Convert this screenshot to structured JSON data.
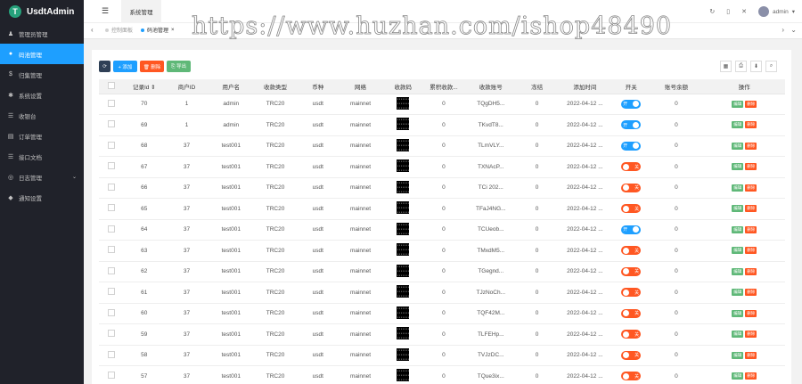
{
  "brand": {
    "logo": "T",
    "name": "UsdtAdmin"
  },
  "sidebar": {
    "items": [
      {
        "icon": "user-icon",
        "glyph": "♟",
        "label": "管理员管理",
        "active": false,
        "chevron": false
      },
      {
        "icon": "coin-icon",
        "glyph": "●",
        "label": "码池管理",
        "active": true,
        "chevron": false
      },
      {
        "icon": "dollar-icon",
        "glyph": "$",
        "label": "归集管理",
        "active": false,
        "chevron": false
      },
      {
        "icon": "gear-icon",
        "glyph": "✱",
        "label": "系统设置",
        "active": false,
        "chevron": false
      },
      {
        "icon": "list-icon",
        "glyph": "☰",
        "label": "收银台",
        "active": false,
        "chevron": false
      },
      {
        "icon": "order-icon",
        "glyph": "▤",
        "label": "订单管理",
        "active": false,
        "chevron": false
      },
      {
        "icon": "doc-icon",
        "glyph": "☰",
        "label": "接口文档",
        "active": false,
        "chevron": false
      },
      {
        "icon": "log-icon",
        "glyph": "◎",
        "label": "日志管理",
        "active": false,
        "chevron": true
      },
      {
        "icon": "bell-icon",
        "glyph": "◆",
        "label": "通知设置",
        "active": false,
        "chevron": false
      }
    ]
  },
  "header": {
    "menu_glyph": "☰",
    "top_tab": "系统管理",
    "user": "admin",
    "icons": {
      "refresh": "↻",
      "lock": "▯",
      "fullscreen": "✕",
      "dropdown": "▾"
    }
  },
  "tabbar": {
    "prev": "‹",
    "next": "›",
    "more": "⌄",
    "tabs": [
      {
        "label": "控制面板",
        "current": false
      },
      {
        "label": "码池管理",
        "current": true,
        "close": "×"
      }
    ]
  },
  "watermark": "https://www.huzhan.com/ishop48490",
  "toolbar": {
    "refresh_glyph": "⟳",
    "add": "+ 添加",
    "delete": "🗑 删除",
    "export": "⎘ 导出",
    "right_icons": [
      "▦",
      "⎙",
      "⬇",
      "⌕"
    ]
  },
  "table": {
    "headers": [
      "",
      "记录Id ⇕",
      "商户ID",
      "用户名",
      "收款类型",
      "币种",
      "网络",
      "收款码",
      "累积收款...",
      "收款账号",
      "冻结",
      "添加时间",
      "开关",
      "账号余额",
      "操作"
    ],
    "switch_on": "开",
    "switch_off": "关",
    "edit_label": "编辑",
    "delete_label": "删除",
    "rows": [
      {
        "id": "70",
        "mch": "1",
        "user": "admin",
        "type": "TRC20",
        "coin": "usdt",
        "net": "mainnet",
        "total": "0",
        "account": "TQgDH5...",
        "frozen": "0",
        "time": "2022-04-12 ...",
        "on": true,
        "balance": "0"
      },
      {
        "id": "69",
        "mch": "1",
        "user": "admin",
        "type": "TRC20",
        "coin": "usdt",
        "net": "mainnet",
        "total": "0",
        "account": "TKvdT8...",
        "frozen": "0",
        "time": "2022-04-12 ...",
        "on": true,
        "balance": "0"
      },
      {
        "id": "68",
        "mch": "37",
        "user": "test001",
        "type": "TRC20",
        "coin": "usdt",
        "net": "mainnet",
        "total": "0",
        "account": "TLmVLY...",
        "frozen": "0",
        "time": "2022-04-12 ...",
        "on": true,
        "balance": "0"
      },
      {
        "id": "67",
        "mch": "37",
        "user": "test001",
        "type": "TRC20",
        "coin": "usdt",
        "net": "mainnet",
        "total": "0",
        "account": "TXNAcP...",
        "frozen": "0",
        "time": "2022-04-12 ...",
        "on": false,
        "balance": "0"
      },
      {
        "id": "66",
        "mch": "37",
        "user": "test001",
        "type": "TRC20",
        "coin": "usdt",
        "net": "mainnet",
        "total": "0",
        "account": "TCi 202...",
        "frozen": "0",
        "time": "2022-04-12 ...",
        "on": false,
        "balance": "0"
      },
      {
        "id": "65",
        "mch": "37",
        "user": "test001",
        "type": "TRC20",
        "coin": "usdt",
        "net": "mainnet",
        "total": "0",
        "account": "TFaJ4NG...",
        "frozen": "0",
        "time": "2022-04-12 ...",
        "on": false,
        "balance": "0"
      },
      {
        "id": "64",
        "mch": "37",
        "user": "test001",
        "type": "TRC20",
        "coin": "usdt",
        "net": "mainnet",
        "total": "0",
        "account": "TCUeob...",
        "frozen": "0",
        "time": "2022-04-12 ...",
        "on": true,
        "balance": "0"
      },
      {
        "id": "63",
        "mch": "37",
        "user": "test001",
        "type": "TRC20",
        "coin": "usdt",
        "net": "mainnet",
        "total": "0",
        "account": "TMxdM5...",
        "frozen": "0",
        "time": "2022-04-12 ...",
        "on": false,
        "balance": "0"
      },
      {
        "id": "62",
        "mch": "37",
        "user": "test001",
        "type": "TRC20",
        "coin": "usdt",
        "net": "mainnet",
        "total": "0",
        "account": "TGegnd...",
        "frozen": "0",
        "time": "2022-04-12 ...",
        "on": false,
        "balance": "0"
      },
      {
        "id": "61",
        "mch": "37",
        "user": "test001",
        "type": "TRC20",
        "coin": "usdt",
        "net": "mainnet",
        "total": "0",
        "account": "TJzNoCh...",
        "frozen": "0",
        "time": "2022-04-12 ...",
        "on": false,
        "balance": "0"
      },
      {
        "id": "60",
        "mch": "37",
        "user": "test001",
        "type": "TRC20",
        "coin": "usdt",
        "net": "mainnet",
        "total": "0",
        "account": "TQF42M...",
        "frozen": "0",
        "time": "2022-04-12 ...",
        "on": false,
        "balance": "0"
      },
      {
        "id": "59",
        "mch": "37",
        "user": "test001",
        "type": "TRC20",
        "coin": "usdt",
        "net": "mainnet",
        "total": "0",
        "account": "TLFEHp...",
        "frozen": "0",
        "time": "2022-04-12 ...",
        "on": false,
        "balance": "0"
      },
      {
        "id": "58",
        "mch": "37",
        "user": "test001",
        "type": "TRC20",
        "coin": "usdt",
        "net": "mainnet",
        "total": "0",
        "account": "TVJzDC...",
        "frozen": "0",
        "time": "2022-04-12 ...",
        "on": false,
        "balance": "0"
      },
      {
        "id": "57",
        "mch": "37",
        "user": "test001",
        "type": "TRC20",
        "coin": "usdt",
        "net": "mainnet",
        "total": "0",
        "account": "TQue3ix...",
        "frozen": "0",
        "time": "2022-04-12 ...",
        "on": false,
        "balance": "0"
      }
    ]
  }
}
